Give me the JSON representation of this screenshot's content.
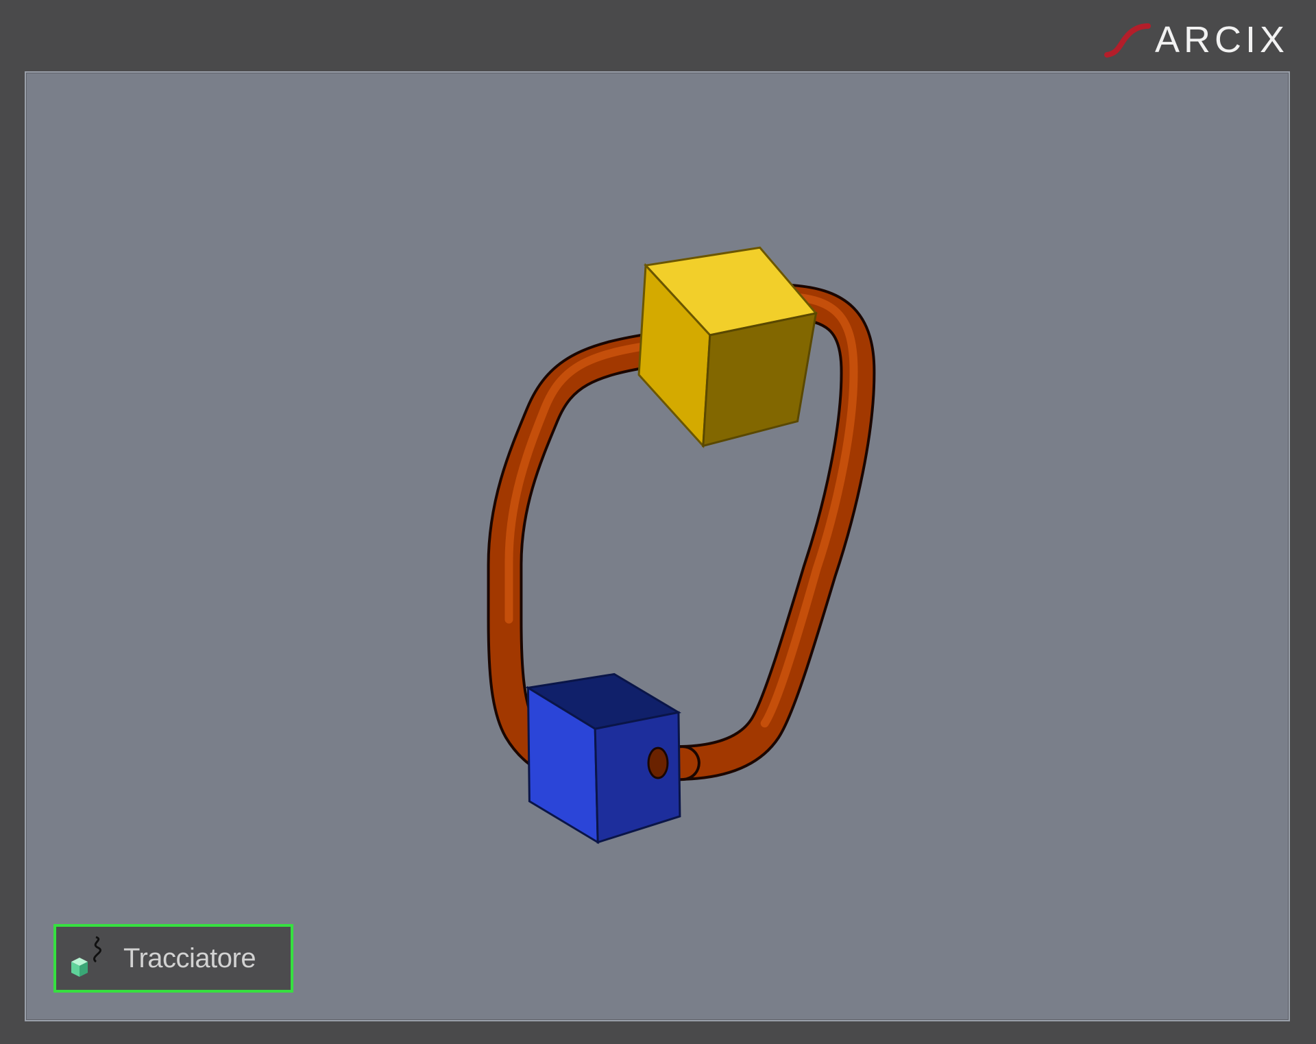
{
  "brand": {
    "name": "ARCIX",
    "mark_color": "#b41e2a"
  },
  "viewport": {
    "background": "#7a7f8a",
    "scene_objects": [
      {
        "name": "yellow-cube",
        "color": "#e0b400"
      },
      {
        "name": "blue-cube",
        "color": "#2a43d6"
      },
      {
        "name": "orange-tube",
        "color": "#b33e00"
      }
    ]
  },
  "tracker_button": {
    "label": "Tracciatore",
    "icon": "tracker-cube-icon",
    "highlight_color": "#36e040"
  }
}
